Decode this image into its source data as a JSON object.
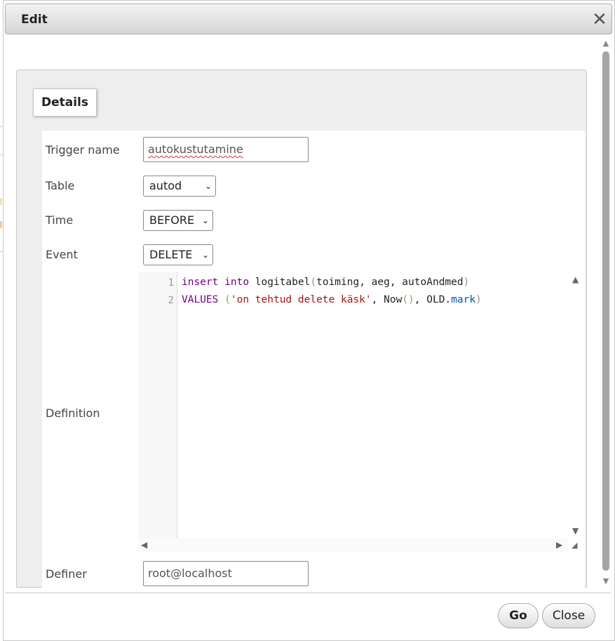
{
  "dialog": {
    "title": "Edit",
    "close_icon": "close-icon"
  },
  "tabs": [
    {
      "label": "Details"
    }
  ],
  "form": {
    "trigger_name": {
      "label": "Trigger name",
      "value": "autokustutamine"
    },
    "table": {
      "label": "Table",
      "value": "autod"
    },
    "time": {
      "label": "Time",
      "value": "BEFORE"
    },
    "event": {
      "label": "Event",
      "value": "DELETE"
    },
    "definition": {
      "label": "Definition",
      "line_numbers": [
        "1",
        "2"
      ],
      "lines": [
        "insert into logitabel(toiming, aeg, autoAndmed)",
        "VALUES ('on tehtud delete käsk', Now(), OLD.mark)"
      ]
    },
    "definer": {
      "label": "Definer",
      "value": "root@localhost"
    }
  },
  "footer": {
    "go_label": "Go",
    "close_label": "Close"
  }
}
